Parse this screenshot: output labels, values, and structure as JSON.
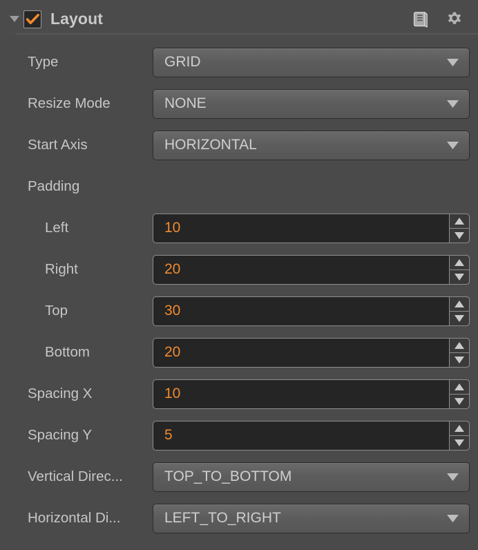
{
  "header": {
    "foldout_icon": "triangle-down-icon",
    "enabled_checkbox": {
      "checked": true,
      "icon": "checkmark-icon"
    },
    "title": "Layout",
    "icons": [
      {
        "name": "book-icon",
        "label": "Documentation"
      },
      {
        "name": "gear-icon",
        "label": "Settings"
      }
    ]
  },
  "colors": {
    "panel_background": "#4a4a4a",
    "header_background": "#4b4b4b",
    "label_text": "#c6c6c6",
    "dropdown_text": "#cfcfcf",
    "value_orange": "#f08a2e",
    "number_field_background": "#252525",
    "field_border": "#8e8e8e",
    "separator": "#575757"
  },
  "rows": [
    {
      "id": "type",
      "label": "Type",
      "indent": 0,
      "control": "dropdown",
      "value": "GRID",
      "arrow_icon": "chevron-down-icon"
    },
    {
      "id": "resize-mode",
      "label": "Resize Mode",
      "indent": 0,
      "control": "dropdown",
      "value": "NONE",
      "arrow_icon": "chevron-down-icon"
    },
    {
      "id": "start-axis",
      "label": "Start Axis",
      "indent": 0,
      "control": "dropdown",
      "value": "HORIZONTAL",
      "arrow_icon": "chevron-down-icon"
    },
    {
      "id": "padding",
      "label": "Padding",
      "indent": 0,
      "control": "none",
      "value": ""
    },
    {
      "id": "padding-left",
      "label": "Left",
      "indent": 1,
      "control": "number",
      "value": "10"
    },
    {
      "id": "padding-right",
      "label": "Right",
      "indent": 1,
      "control": "number",
      "value": "20"
    },
    {
      "id": "padding-top",
      "label": "Top",
      "indent": 1,
      "control": "number",
      "value": "30"
    },
    {
      "id": "padding-bottom",
      "label": "Bottom",
      "indent": 1,
      "control": "number",
      "value": "20"
    },
    {
      "id": "spacing-x",
      "label": "Spacing X",
      "indent": 0,
      "control": "number",
      "value": "10"
    },
    {
      "id": "spacing-y",
      "label": "Spacing Y",
      "indent": 0,
      "control": "number",
      "value": "5"
    },
    {
      "id": "vertical-direction",
      "label": "Vertical Direc...",
      "indent": 0,
      "control": "dropdown",
      "value": "TOP_TO_BOTTOM",
      "arrow_icon": "chevron-down-icon"
    },
    {
      "id": "horizontal-direction",
      "label": "Horizontal Di...",
      "indent": 0,
      "control": "dropdown",
      "value": "LEFT_TO_RIGHT",
      "arrow_icon": "chevron-down-icon"
    }
  ]
}
